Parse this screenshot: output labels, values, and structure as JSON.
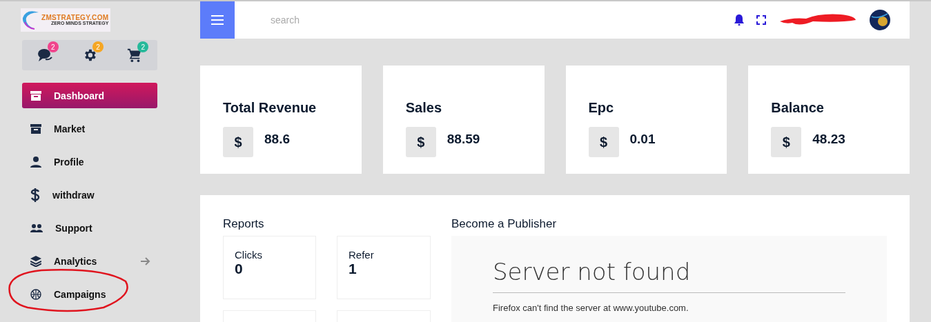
{
  "logo": {
    "title": "ZMSTRATEGY.COM",
    "subtitle": "ZERO MINDS STRATEGY"
  },
  "quick_icons": [
    {
      "kind": "chat",
      "count": "2",
      "color": "#f0448c"
    },
    {
      "kind": "gear",
      "count": "2",
      "color": "#f5a623"
    },
    {
      "kind": "cart",
      "count": "2",
      "color": "#26b99a"
    }
  ],
  "sidebar": {
    "items": [
      {
        "kind": "archive",
        "label": "Dashboard",
        "selected": true
      },
      {
        "kind": "archive",
        "label": "Market",
        "selected": false
      },
      {
        "kind": "person",
        "label": "Profile",
        "selected": false
      },
      {
        "kind": "dollar",
        "label": "withdraw",
        "selected": false
      },
      {
        "kind": "people",
        "label": "Support",
        "selected": false
      },
      {
        "kind": "layers",
        "label": "Analytics",
        "selected": false,
        "arrow": true
      },
      {
        "kind": "ball",
        "label": "Campaigns",
        "selected": false,
        "circled": true
      }
    ]
  },
  "topbar": {
    "search": {
      "placeholder": "search"
    }
  },
  "stats": [
    {
      "title": "Total Revenue",
      "currency": "$",
      "value": "88.6"
    },
    {
      "title": "Sales",
      "currency": "$",
      "value": "88.59"
    },
    {
      "title": "Epc",
      "currency": "$",
      "value": "0.01"
    },
    {
      "title": "Balance",
      "currency": "$",
      "value": "48.23"
    }
  ],
  "reports": {
    "title": "Reports",
    "tiles": [
      {
        "kind": "stat",
        "label": "Clicks",
        "value": "0"
      },
      {
        "kind": "stat",
        "label": "Refer",
        "value": "1"
      },
      {
        "kind": "blank"
      },
      {
        "kind": "blank"
      }
    ]
  },
  "publisher": {
    "title": "Become a Publisher",
    "error_title": "Server not found",
    "error_text": "Firefox can't find the server at www.youtube.com."
  }
}
